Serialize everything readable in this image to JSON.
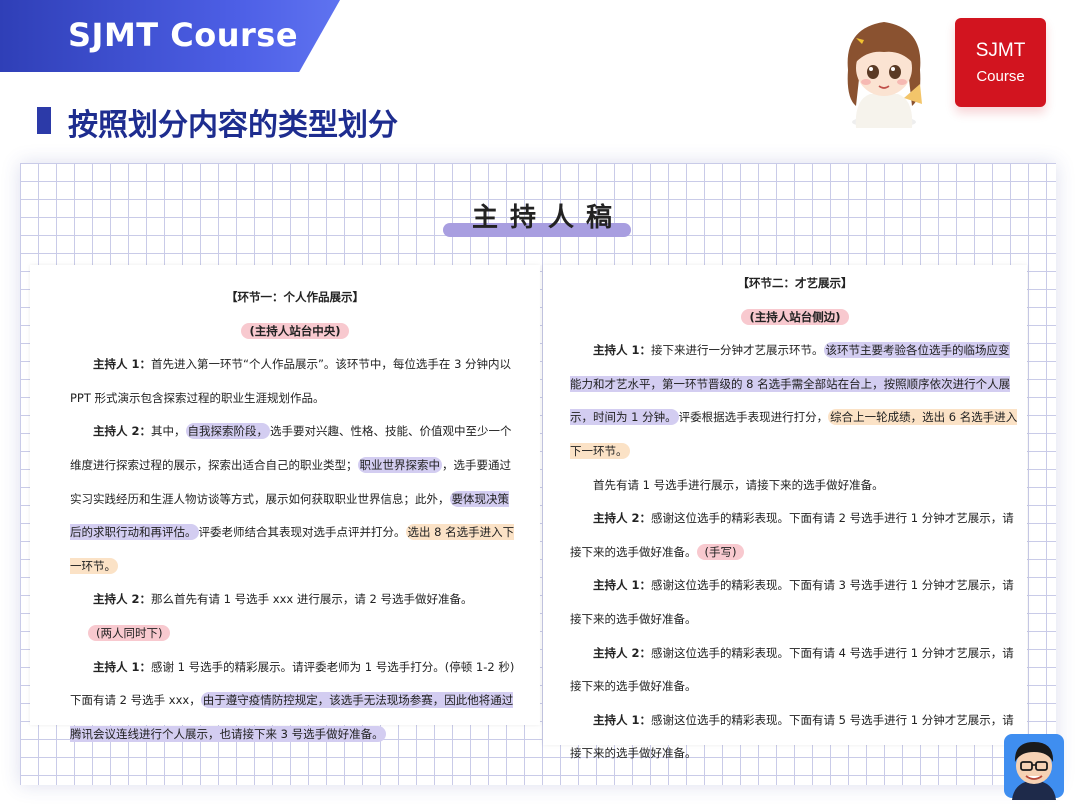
{
  "header": {
    "brand": "SJMT Course",
    "title": "按照划分内容的类型划分",
    "badge_line1": "SJMT",
    "badge_line2": "Course"
  },
  "doc": {
    "title": "主持人稿",
    "left": {
      "heading": "【环节一：个人作品展示】",
      "stage_note": "(主持人站台中央)",
      "p1_speaker": "主持人 1：",
      "p1_text": "首先进入第一环节“个人作品展示”。该环节中，每位选手在 3 分钟内以 PPT 形式演示包含探索过程的职业生涯规划作品。",
      "p2_speaker": "主持人 2：",
      "p2_a": "其中，",
      "p2_hl1": "自我探索阶段，",
      "p2_b": "选手要对兴趣、性格、技能、价值观中至少一个维度进行探索过程的展示，探索出适合自己的职业类型；",
      "p2_hl2": "职业世界探索中",
      "p2_c": "，选手要通过实习实践经历和生涯人物访谈等方式，展示如何获取职业世界信息；此外，",
      "p2_hl3": "要体现决策后的求职行动和再评估。",
      "p2_d": "评委老师结合其表现对选手点评并打分。",
      "p2_hl4": "选出 8 名选手进入下一环节。",
      "p3_speaker": "主持人 2：",
      "p3_text": "那么首先有请 1 号选手 xxx 进行展示，请 2 号选手做好准备。",
      "note2": "(两人同时下)",
      "p4_speaker": "主持人 1：",
      "p4_text": "感谢 1 号选手的精彩展示。请评委老师为 1 号选手打分。(停顿 1-2 秒) 下面有请 2 号选手 xxx，",
      "p4_hl": "由于遵守疫情防控规定，该选手无法现场参赛，因此他将通过腾讯会议连线进行个人展示，也请接下来 3 号选手做好准备。"
    },
    "right": {
      "heading": "【环节二：才艺展示】",
      "stage_note": "(主持人站台侧边)",
      "p1_speaker": "主持人 1：",
      "p1_a": "接下来进行一分钟才艺展示环节。",
      "p1_hl1": "该环节主要考验各位选手的临场应变能力和才艺水平，第一环节晋级的 8 名选手需全部站在台上，按照顺序依次进行个人展示，时间为 1 分钟。",
      "p1_b": "评委根据选手表现进行打分，",
      "p1_hl2": "综合上一轮成绩，选出 6 名选手进入下一环节。",
      "p2_text": "首先有请 1 号选手进行展示，请接下来的选手做好准备。",
      "p3_speaker": "主持人 2：",
      "p3_text": "感谢这位选手的精彩表现。下面有请 2 号选手进行 1 分钟才艺展示，请接下来的选手做好准备。",
      "p3_note": "(手写)",
      "p4_speaker": "主持人 1：",
      "p4_text": "感谢这位选手的精彩表现。下面有请 3 号选手进行 1 分钟才艺展示，请接下来的选手做好准备。",
      "p5_speaker": "主持人 2：",
      "p5_text": "感谢这位选手的精彩表现。下面有请 4 号选手进行 1 分钟才艺展示，请接下来的选手做好准备。",
      "p6_speaker": "主持人 1：",
      "p6_text": "感谢这位选手的精彩表现。下面有请 5 号选手进行 1 分钟才艺展示，请接下来的选手做好准备。"
    }
  },
  "colors": {
    "brand_blue": "#2f3fb7",
    "title_blue": "#1e2d8f",
    "badge_red": "#d2141f",
    "highlight_purple": "#d3cdf1",
    "highlight_orange": "#fbe2c6",
    "highlight_pink": "#f8c9cf"
  },
  "icons": [
    "girl-avatar-icon",
    "boy-avatar-icon"
  ]
}
